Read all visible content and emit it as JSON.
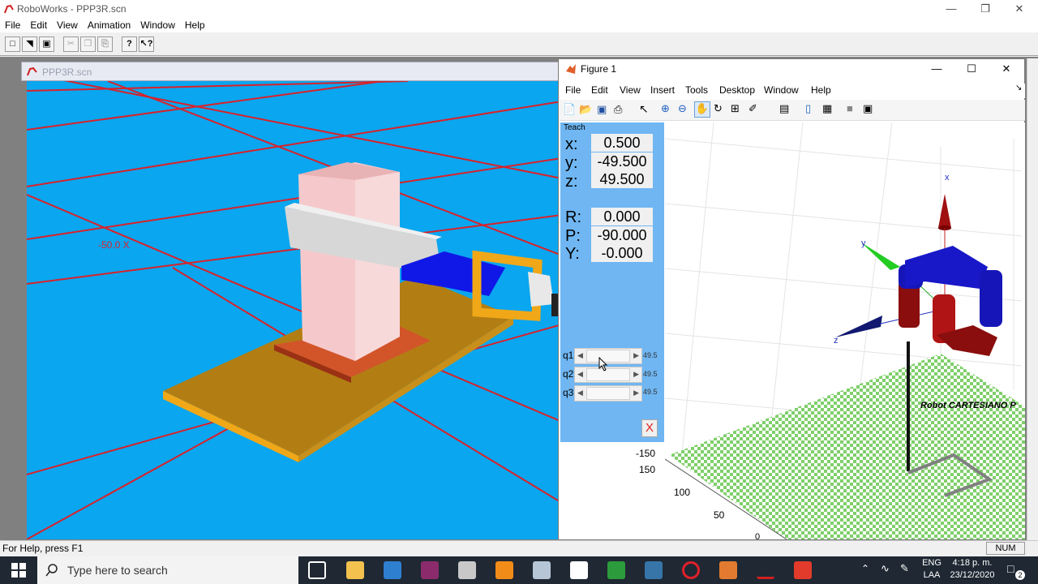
{
  "app": {
    "title": "RoboWorks - PPP3R.scn",
    "menu": [
      "File",
      "Edit",
      "View",
      "Animation",
      "Window",
      "Help"
    ],
    "toolbar_icons": [
      "new-file",
      "open-file",
      "save-file",
      "cut",
      "copy",
      "paste",
      "help",
      "context-help"
    ]
  },
  "child": {
    "title": "PPP3R.scn",
    "scene_label": "-50.0 X"
  },
  "figure": {
    "title": "Figure 1",
    "menu": [
      "File",
      "Edit",
      "View",
      "Insert",
      "Tools",
      "Desktop",
      "Window",
      "Help"
    ],
    "teach": {
      "heading": "Teach",
      "x_label": "x:",
      "x_value": "0.500",
      "y_label": "y:",
      "y_value": "-49.500",
      "z_label": "z:",
      "z_value": "49.500",
      "r_label": "R:",
      "r_value": "0.000",
      "p_label": "P:",
      "p_value": "-90.000",
      "yaw_label": "Y:",
      "yaw_value": "-0.000",
      "q1_label": "q1",
      "q1_value": "49.5",
      "q2_label": "q2",
      "q2_value": "49.5",
      "q3_label": "q3",
      "q3_value": "49.5",
      "close_label": "X"
    },
    "plot": {
      "robot_label": "Robot CARTESIANO P",
      "axis_x": "x",
      "axis_y": "y",
      "axis_z": "z",
      "ticks": [
        "-150",
        "150",
        "100",
        "50",
        "0"
      ]
    }
  },
  "status": {
    "help_text": "For Help, press F1",
    "num": "NUM"
  },
  "taskbar": {
    "search_placeholder": "Type here to search",
    "lang_1": "ENG",
    "lang_2": "LAA",
    "time": "4:18 p. m.",
    "date": "23/12/2020",
    "notifications": "2"
  }
}
